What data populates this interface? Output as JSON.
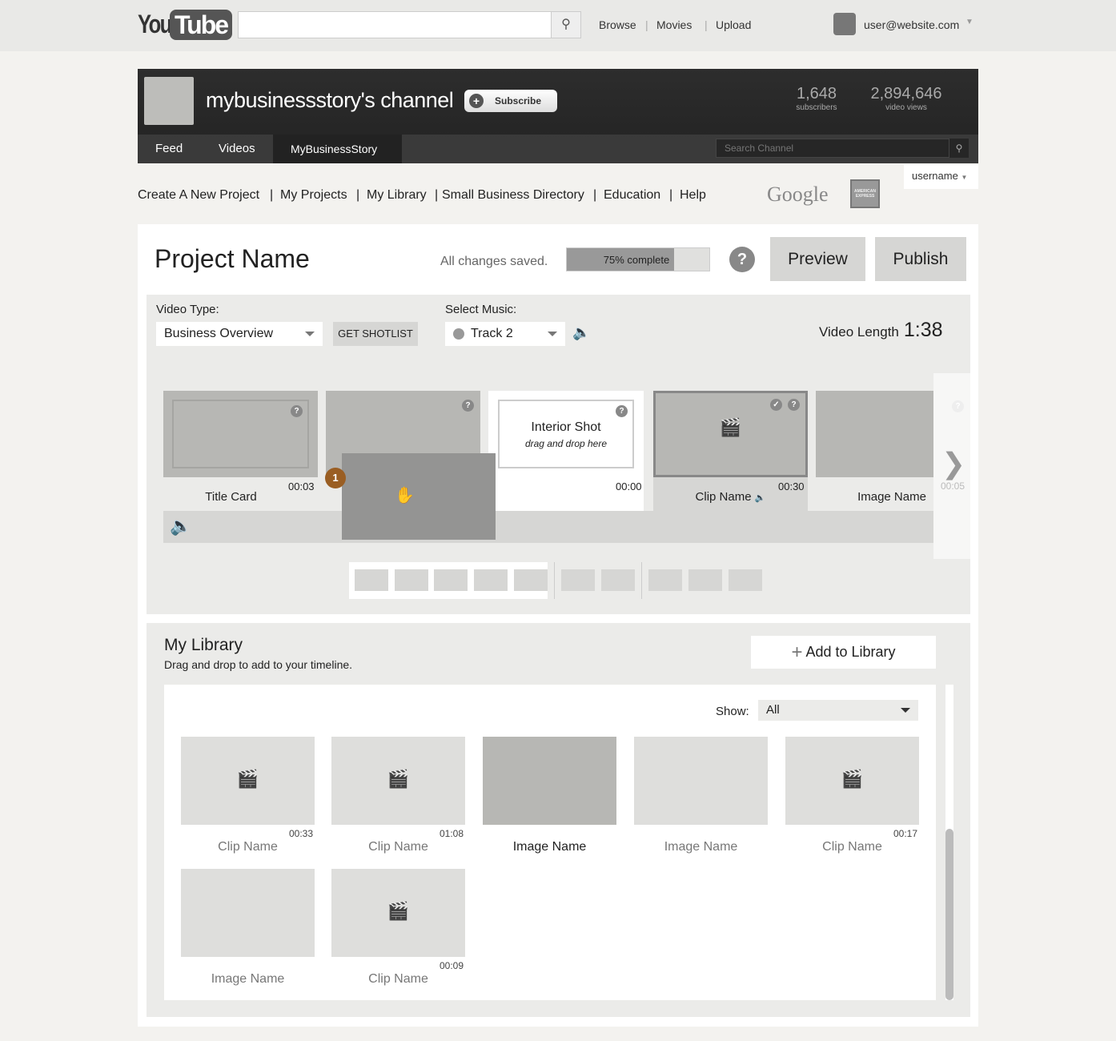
{
  "topbar": {
    "logo": "YouTube",
    "logo_you": "You",
    "logo_tube": "Tube",
    "search_placeholder": "",
    "links": [
      "Browse",
      "Movies",
      "Upload"
    ],
    "user": "user@website.com"
  },
  "channel": {
    "title": "mybusinessstory's channel",
    "subscribe": "Subscribe",
    "stats": [
      {
        "value": "1,648",
        "label": "subscribers"
      },
      {
        "value": "2,894,646",
        "label": "video views"
      }
    ],
    "tabs": [
      "Feed",
      "Videos",
      "MyBusinessStory"
    ],
    "active_tab": "MyBusinessStory",
    "search_placeholder": "Search Channel",
    "username": "username"
  },
  "nav": [
    "Create A New Project",
    "My Projects",
    "My Library",
    "Small Business Directory",
    "Education",
    "Help"
  ],
  "sponsors": {
    "google": "Google",
    "amex": "American Express"
  },
  "project": {
    "title": "Project Name",
    "status": "All changes saved.",
    "progress_percent": 75,
    "progress_label": "75% complete",
    "help": "?",
    "preview": "Preview",
    "publish": "Publish"
  },
  "editor": {
    "video_type_label": "Video Type:",
    "video_type": "Business Overview",
    "shotlist": "GET SHOTLIST",
    "music_label": "Select Music:",
    "music": "Track 2",
    "length_label": "Video Length",
    "length": "1:38",
    "clips": [
      {
        "name": "Title Card",
        "duration": "00:03"
      },
      {
        "name": "",
        "duration": ""
      },
      {
        "name": "Interior Shot",
        "hint": "drag and drop here",
        "duration": "00:00"
      },
      {
        "name": "Clip Name",
        "duration": "00:30"
      },
      {
        "name": "Image Name",
        "duration": ""
      },
      {
        "name": "",
        "duration": "00:05"
      }
    ],
    "drag_badge": "1"
  },
  "library": {
    "title": "My Library",
    "subtitle": "Drag and drop to add to your timeline.",
    "add": "Add to Library",
    "show_label": "Show:",
    "show_value": "All",
    "items": [
      {
        "name": "Clip Name",
        "duration": "00:33",
        "type": "clip"
      },
      {
        "name": "Clip Name",
        "duration": "01:08",
        "type": "clip"
      },
      {
        "name": "Image Name",
        "duration": "",
        "type": "image",
        "selected": true
      },
      {
        "name": "Image Name",
        "duration": "",
        "type": "image"
      },
      {
        "name": "Clip Name",
        "duration": "00:17",
        "type": "clip"
      },
      {
        "name": "Image Name",
        "duration": "",
        "type": "image"
      },
      {
        "name": "Clip Name",
        "duration": "00:09",
        "type": "clip"
      }
    ]
  },
  "colors": {
    "badge": "#9a5e23",
    "banner": "#2a2a2a"
  }
}
